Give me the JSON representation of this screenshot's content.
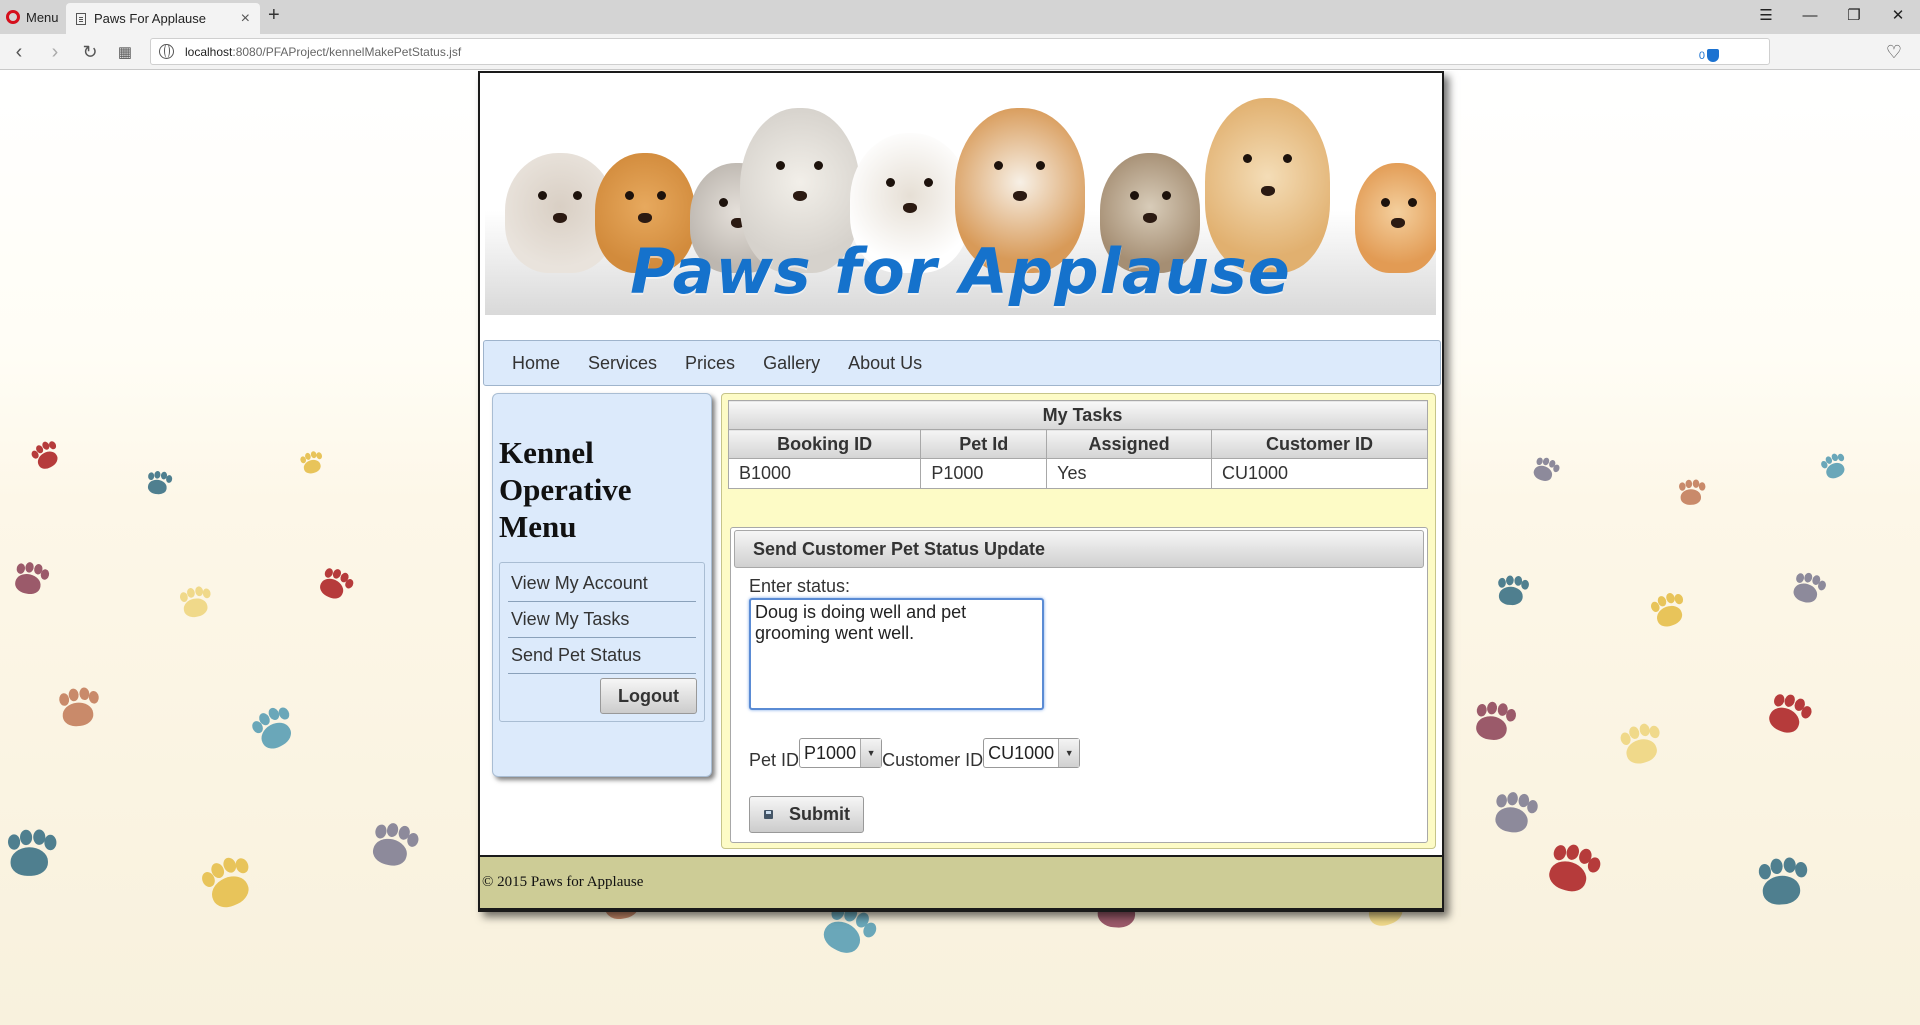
{
  "browser": {
    "menu_label": "Menu",
    "tab_title": "Paws For Applause",
    "url_host": "localhost",
    "url_rest": ":8080/PFAProject/kennelMakePetStatus.jsf",
    "adblock_count": "0"
  },
  "site": {
    "banner_title": "Paws for Applause",
    "nav": [
      "Home",
      "Services",
      "Prices",
      "Gallery",
      "About Us"
    ]
  },
  "sidebar": {
    "title": "Kennel Operative Menu",
    "items": [
      "View My Account",
      "View My Tasks",
      "Send Pet Status"
    ],
    "logout_label": "Logout"
  },
  "tasks": {
    "caption": "My Tasks",
    "columns": [
      "Booking ID",
      "Pet Id",
      "Assigned",
      "Customer ID"
    ],
    "rows": [
      [
        "B1000",
        "P1000",
        "Yes",
        "CU1000"
      ]
    ]
  },
  "status_form": {
    "header": "Send Customer Pet Status Update",
    "status_label": "Enter status:",
    "status_value": "Doug is doing well and pet grooming went well.",
    "pet_id_label": "Pet ID",
    "pet_id_value": "P1000",
    "customer_id_label": "Customer ID",
    "customer_id_value": "CU1000",
    "submit_label": "Submit"
  },
  "footer": {
    "text": "© 2015 Paws for Applause"
  },
  "colors": {
    "banner_title": "#1572cc",
    "menubar_bg": "#dceafb",
    "content_bg": "#fdfbc6",
    "footer_bg": "#cdcc96"
  }
}
